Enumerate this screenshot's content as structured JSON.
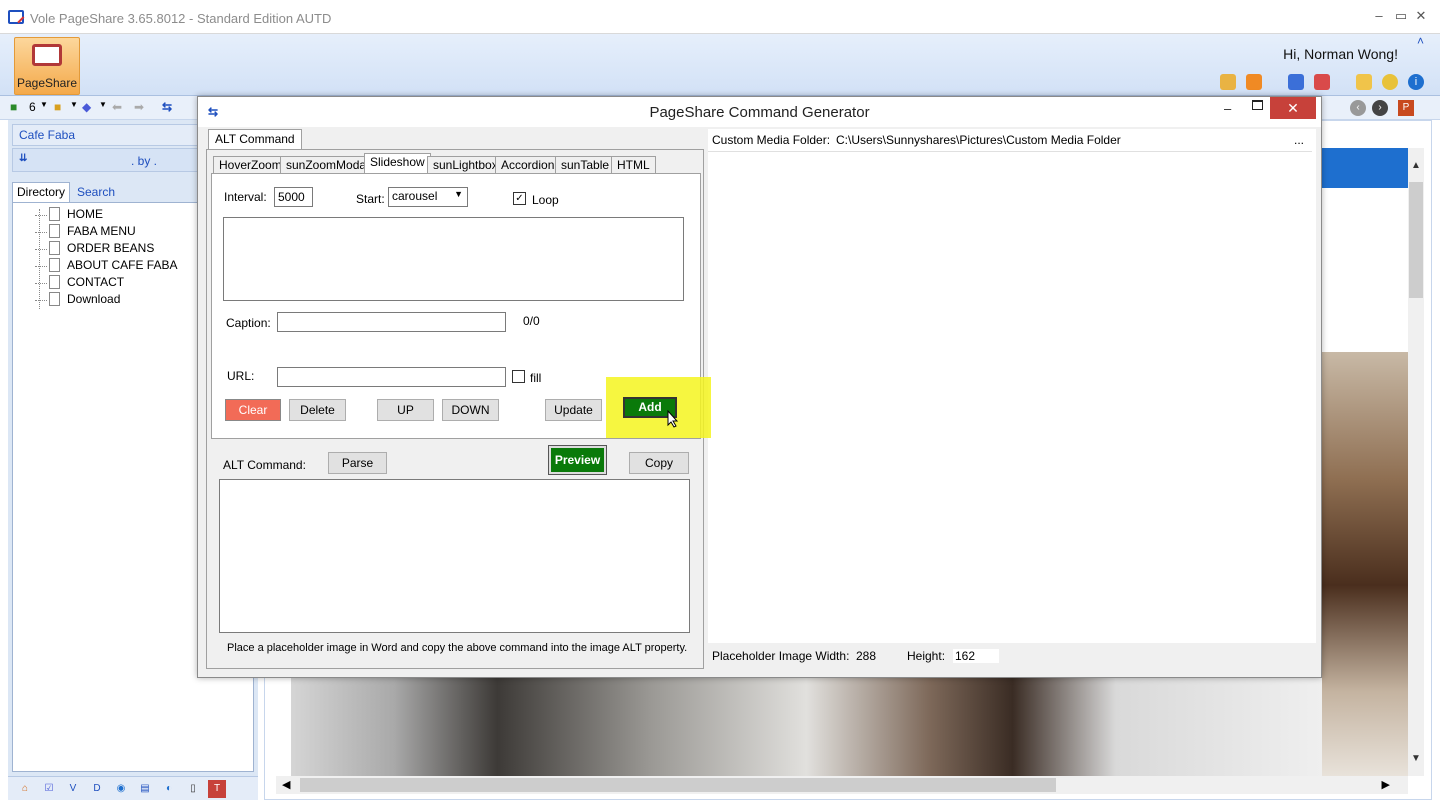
{
  "window": {
    "title": "Vole PageShare  3.65.8012 - Standard Edition AUTD",
    "minimize": "–",
    "maximize": "▭",
    "close": "✕"
  },
  "ribbon": {
    "button_label": "PageShare",
    "greeting": "Hi, Norman Wong!",
    "collapse": "˄"
  },
  "toolbar": {
    "count": "6"
  },
  "sidebar": {
    "site_name": "Cafe Faba",
    "by_text": ". by .",
    "tabs": [
      {
        "label": "Directory"
      },
      {
        "label": "Search"
      }
    ],
    "tree": [
      {
        "label": "HOME"
      },
      {
        "label": "FABA MENU"
      },
      {
        "label": "ORDER BEANS"
      },
      {
        "label": "ABOUT CAFE FABA"
      },
      {
        "label": "CONTACT"
      },
      {
        "label": "Download"
      }
    ]
  },
  "dialog": {
    "title": "PageShare Command Generator",
    "top_tab": "ALT Command",
    "sub_tabs": [
      {
        "label": "HoverZoom"
      },
      {
        "label": "sunZoomModal"
      },
      {
        "label": "Slideshow"
      },
      {
        "label": "sunLightbox"
      },
      {
        "label": "Accordion"
      },
      {
        "label": "sunTable"
      },
      {
        "label": "HTML"
      }
    ],
    "slideshow": {
      "interval_label": "Interval:",
      "interval_value": "5000",
      "start_label": "Start:",
      "start_value": "carousel",
      "loop_label": "Loop",
      "caption_label": "Caption:",
      "caption_counter": "0/0",
      "url_label": "URL:",
      "fill_label": "fill",
      "buttons": {
        "clear": "Clear",
        "delete": "Delete",
        "up": "UP",
        "down": "DOWN",
        "update": "Update",
        "add": "Add"
      }
    },
    "alt_command_label": "ALT Command:",
    "parse": "Parse",
    "preview": "Preview",
    "copy": "Copy",
    "hint": "Place a placeholder image in Word and copy the above command into the image ALT property.",
    "media_folder_label": "Custom Media Folder:",
    "media_folder_path": "C:\\Users\\Sunnyshares\\Pictures\\Custom Media Folder",
    "media_more": "...",
    "placeholder_width_label": "Placeholder Image Width:",
    "placeholder_width": "288",
    "height_label": "Height:",
    "placeholder_height": "162"
  },
  "colors": {
    "accent": "#1e4fbf",
    "add_button": "#0a7a0a",
    "clear_button": "#f26b57",
    "close_button": "#c7413a",
    "highlight": "#f5f51e"
  }
}
